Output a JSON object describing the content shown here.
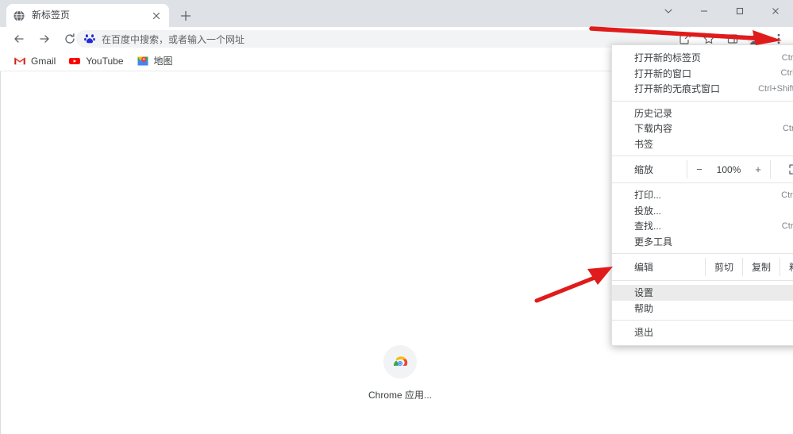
{
  "window": {
    "controls": [
      {
        "name": "chevron-down",
        "glyph": "⌄"
      },
      {
        "name": "minimize",
        "glyph": "−"
      },
      {
        "name": "maximize",
        "glyph": "□"
      },
      {
        "name": "close",
        "glyph": "✕"
      }
    ]
  },
  "tab": {
    "title": "新标签页",
    "favicon": "globe-icon",
    "close_label": "✕",
    "new_tab_label": "+"
  },
  "toolbar": {
    "back_label": "←",
    "forward_label": "→",
    "reload_label": "⟳",
    "omnibox": {
      "icon": "baidu-icon",
      "placeholder": "在百度中搜索，或者输入一个网址",
      "value": ""
    },
    "right_icons": [
      {
        "name": "share-icon"
      },
      {
        "name": "bookmark-star-icon"
      },
      {
        "name": "side-panel-icon"
      },
      {
        "name": "profile-avatar"
      },
      {
        "name": "three-dot-menu-icon"
      }
    ]
  },
  "bookmarks": [
    {
      "label": "Gmail",
      "icon": "gmail-icon"
    },
    {
      "label": "YouTube",
      "icon": "youtube-icon"
    },
    {
      "label": "地图",
      "icon": "maps-icon"
    }
  ],
  "page": {
    "shortcut": {
      "label": "Chrome 应用...",
      "icon": "chrome-apps-icon"
    }
  },
  "menu": {
    "groups": [
      {
        "items": [
          {
            "label": "打开新的标签页",
            "accel": "Ctrl+T",
            "submenu": false
          },
          {
            "label": "打开新的窗口",
            "accel": "Ctrl+N",
            "submenu": false
          },
          {
            "label": "打开新的无痕式窗口",
            "accel": "Ctrl+Shift+N",
            "submenu": false
          }
        ]
      },
      {
        "items": [
          {
            "label": "历史记录",
            "accel": "",
            "submenu": true
          },
          {
            "label": "下载内容",
            "accel": "Ctrl+J",
            "submenu": false
          },
          {
            "label": "书签",
            "accel": "",
            "submenu": true
          }
        ]
      },
      {
        "items": [
          {
            "label": "打印...",
            "accel": "Ctrl+P",
            "submenu": false
          },
          {
            "label": "投放...",
            "accel": "",
            "submenu": false
          },
          {
            "label": "查找...",
            "accel": "Ctrl+F",
            "submenu": false
          },
          {
            "label": "更多工具",
            "accel": "",
            "submenu": true
          }
        ]
      },
      {
        "items": [
          {
            "label": "设置",
            "accel": "",
            "submenu": false,
            "highlighted": true
          },
          {
            "label": "帮助",
            "accel": "",
            "submenu": true
          }
        ]
      },
      {
        "items": [
          {
            "label": "退出",
            "accel": "",
            "submenu": false
          }
        ]
      }
    ],
    "zoom_row": {
      "label": "缩放",
      "minus": "−",
      "value": "100%",
      "plus": "+",
      "fullscreen_icon": "fullscreen-icon"
    },
    "edit_row": {
      "label": "编辑",
      "cut": "剪切",
      "copy": "复制",
      "paste": "粘贴"
    }
  },
  "annotations": {
    "arrow_color": "#e01b1b",
    "arrows": [
      {
        "name": "arrow-to-three-dot-menu",
        "points_to": "three-dot-menu-icon"
      },
      {
        "name": "arrow-to-settings",
        "points_to": "设置"
      }
    ]
  }
}
